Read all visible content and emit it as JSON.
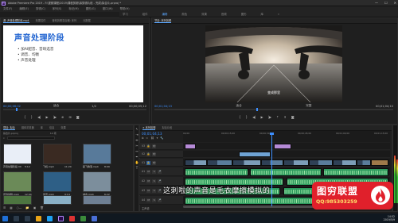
{
  "window": {
    "app_badge": "Pr",
    "title": "Adobe Premiere Pro 2019 - F:\\视频课程\\2019\\课程剪辑\\拟剪辑片段 - 完成\\拟合片.prproj *",
    "controls": [
      "—",
      "☐",
      "✕"
    ]
  },
  "menu": [
    "文件(F)",
    "编辑(E)",
    "剪辑(C)",
    "序列(S)",
    "标记(M)",
    "图形(G)",
    "窗口(W)",
    "帮助(H)"
  ],
  "workspaces": {
    "items": [
      "学习",
      "组件",
      "编辑",
      "颜色",
      "效果",
      "音频",
      "图形",
      "库",
      "»"
    ],
    "active_index": 2
  },
  "source": {
    "tabs": [
      "源: 声音处理阶段.mp4",
      "效果控件",
      "音频剪辑混合器: 序列",
      "元数据"
    ],
    "slide_heading": "声音处理阶段",
    "bullets": [
      "• 加AI配音、音响选音",
      "• 调音、均衡",
      "• 声音处理"
    ],
    "timecode_in": "00;00;06;02",
    "fit": "适合",
    "fraction": "1/2",
    "timecode_out": "00;00;05;12"
  },
  "program": {
    "tabs": [
      "节目: 序列剪辑"
    ],
    "subtitle": "变成那里",
    "timecode_in": "00;01;04;13",
    "fit": "适合",
    "fraction": "完整",
    "timecode_out": "00;01;04;10"
  },
  "project": {
    "tabs": [
      "项目: 拟合",
      "媒体浏览器",
      "库",
      "信息",
      "效果"
    ],
    "path": "拟合片.prproj",
    "count": "14 项",
    "clips": [
      {
        "label": "声音处理阶段 00",
        "duration": "5:12",
        "color": "#e9eef7"
      },
      {
        "label": "飞机.mp4",
        "duration": "11:20",
        "color": "#3a2a22"
      },
      {
        "label": "起飞降落.mp4",
        "duration": "8:09",
        "color": "#587a9a"
      },
      {
        "label": "序列剪辑.mp4",
        "duration": "12:04",
        "color": "#6b8a58"
      },
      {
        "label": "风景.mp4",
        "duration": "9:14",
        "color": "#2e5f86"
      },
      {
        "label": "城市.mp4",
        "duration": "6:22",
        "color": "#7c8e9c"
      },
      {
        "label": "山川.mp4",
        "duration": "4:18",
        "color": "#4d7540"
      },
      {
        "label": "湖泊.mp4",
        "duration": "7:01",
        "color": "#8ab0c6"
      },
      {
        "label": "天空.mp4",
        "duration": "3:25",
        "color": "#6e7f93"
      }
    ]
  },
  "timeline": {
    "tabs": [
      "× 序列剪辑",
      "拟合片段"
    ],
    "timecode": "00;01;04;13",
    "ruler": [
      "00;00",
      "00;00;15;00",
      "00;00;30;00",
      "00;00;45;00",
      "00;01;00;00",
      "00;01;15;00"
    ],
    "tracks": [
      {
        "name": "V3",
        "kind": "video"
      },
      {
        "name": "V2",
        "kind": "video"
      },
      {
        "name": "V1",
        "kind": "video"
      },
      {
        "name": "A1",
        "kind": "audio"
      },
      {
        "name": "A2",
        "kind": "audio"
      },
      {
        "name": "A3",
        "kind": "audio"
      },
      {
        "name": "A4",
        "kind": "audio"
      }
    ],
    "master": "主声道"
  },
  "overlay": {
    "caption": "这刺啦的声音是毛衣摩擦模拟的",
    "logo_name": "图穷联盟",
    "logo_contact": "QQ:985303259",
    "brand_color": "#e0202b"
  },
  "taskbar": {
    "time": "14:52",
    "date": "2019/5/9"
  },
  "colors": {
    "accent": "#3d8fff",
    "video_clip": "#6fa3d4",
    "audio_clip": "#2e9a5e",
    "audio_wave": "#9ee6a6"
  }
}
